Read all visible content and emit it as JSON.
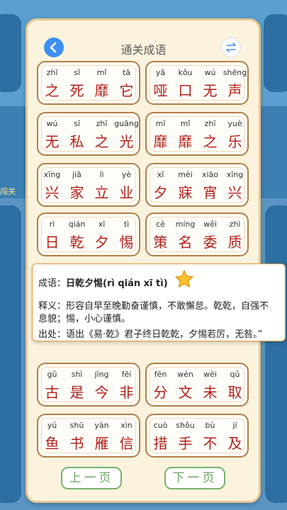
{
  "background": {
    "caption": "闯关"
  },
  "header": {
    "title": "通关成语",
    "back_icon": "chevron-left-icon",
    "switch_icon": "swap-icon"
  },
  "idioms": [
    [
      {
        "py": [
          "zhī",
          "sǐ",
          "mǐ",
          "tā"
        ],
        "ch": [
          "之",
          "死",
          "靡",
          "它"
        ]
      },
      {
        "py": [
          "yǎ",
          "kǒu",
          "wú",
          "shēng"
        ],
        "ch": [
          "哑",
          "口",
          "无",
          "声"
        ]
      }
    ],
    [
      {
        "py": [
          "wú",
          "sī",
          "zhī",
          "guāng"
        ],
        "ch": [
          "无",
          "私",
          "之",
          "光"
        ]
      },
      {
        "py": [
          "mǐ",
          "mǐ",
          "zhī",
          "yuè"
        ],
        "ch": [
          "靡",
          "靡",
          "之",
          "乐"
        ]
      }
    ],
    [
      {
        "py": [
          "xīng",
          "jiā",
          "lì",
          "yè"
        ],
        "ch": [
          "兴",
          "家",
          "立",
          "业"
        ]
      },
      {
        "py": [
          "xī",
          "mèi",
          "xiāo",
          "xīng"
        ],
        "ch": [
          "夕",
          "寐",
          "宵",
          "兴"
        ]
      }
    ],
    [
      {
        "py": [
          "rì",
          "qián",
          "xī",
          "tì"
        ],
        "ch": [
          "日",
          "乾",
          "夕",
          "惕"
        ]
      },
      {
        "py": [
          "cè",
          "míng",
          "wěi",
          "zhì"
        ],
        "ch": [
          "策",
          "名",
          "委",
          "质"
        ]
      }
    ],
    [
      {
        "py": [
          "gǔ",
          "shì",
          "jīng",
          "fēi"
        ],
        "ch": [
          "古",
          "是",
          "今",
          "非"
        ]
      },
      {
        "py": [
          "fēn",
          "wén",
          "wèi",
          "qǔ"
        ],
        "ch": [
          "分",
          "文",
          "未",
          "取"
        ]
      }
    ],
    [
      {
        "py": [
          "yú",
          "shū",
          "yàn",
          "xìn"
        ],
        "ch": [
          "鱼",
          "书",
          "雁",
          "信"
        ]
      },
      {
        "py": [
          "cuò",
          "shǒu",
          "bù",
          "jí"
        ],
        "ch": [
          "措",
          "手",
          "不",
          "及"
        ]
      }
    ]
  ],
  "popup": {
    "head_label": "成语：",
    "idiom": "日乾夕惕(rì qián xī tì)",
    "def_line1": "释义：形容自早至晚勤奋谨慎，不敢懈怠。乾乾，自强不",
    "def_line2": "息貌；惕，小心谨慎。",
    "source": "出处：语出《易·乾》君子终日乾乾，夕惕若厉，无咎。”",
    "star_icon": "star-icon"
  },
  "nav": {
    "prev_label": "上一页",
    "next_label": "下一页"
  }
}
